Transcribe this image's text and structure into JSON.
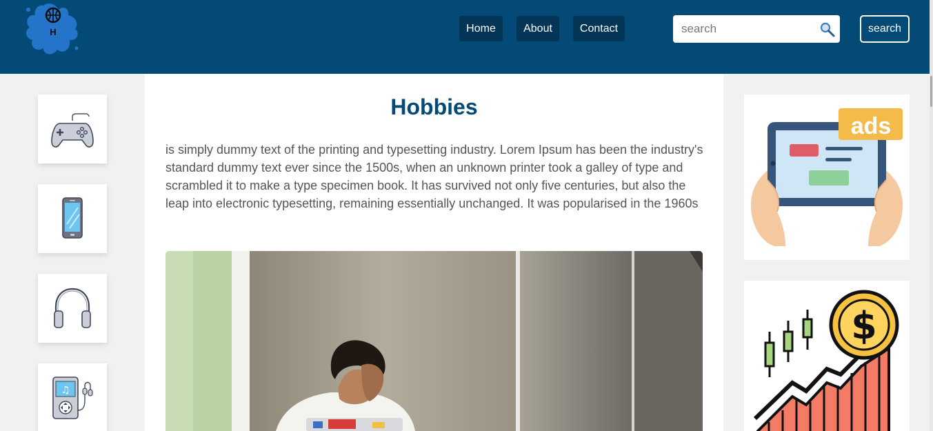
{
  "header": {
    "logo_letter": "H",
    "nav": [
      {
        "label": "Home"
      },
      {
        "label": "About"
      },
      {
        "label": "Contact"
      }
    ],
    "search": {
      "placeholder": "search",
      "value": "",
      "button_label": "search"
    },
    "colors": {
      "bar": "#034a76",
      "nav_button": "#023556"
    }
  },
  "sidebar": {
    "items": [
      {
        "icon": "gamepad-icon"
      },
      {
        "icon": "smartphone-icon"
      },
      {
        "icon": "headphones-icon"
      },
      {
        "icon": "music-player-icon"
      }
    ]
  },
  "main": {
    "title": "Hobbies",
    "paragraph": "is simply dummy text of the printing and typesetting industry. Lorem Ipsum has been the industry's standard dummy text ever since the 1500s, when an unknown printer took a galley of type and scrambled it to make a type specimen book. It has survived not only five centuries, but also the leap into electronic typesetting, remaining essentially unchanged. It was popularised in the 1960s",
    "image": "stressed-man-at-laptop-photo"
  },
  "ads": {
    "tablet_ad_text": "ads",
    "icons": [
      "tablet-ads-icon",
      "finance-growth-icon"
    ]
  }
}
